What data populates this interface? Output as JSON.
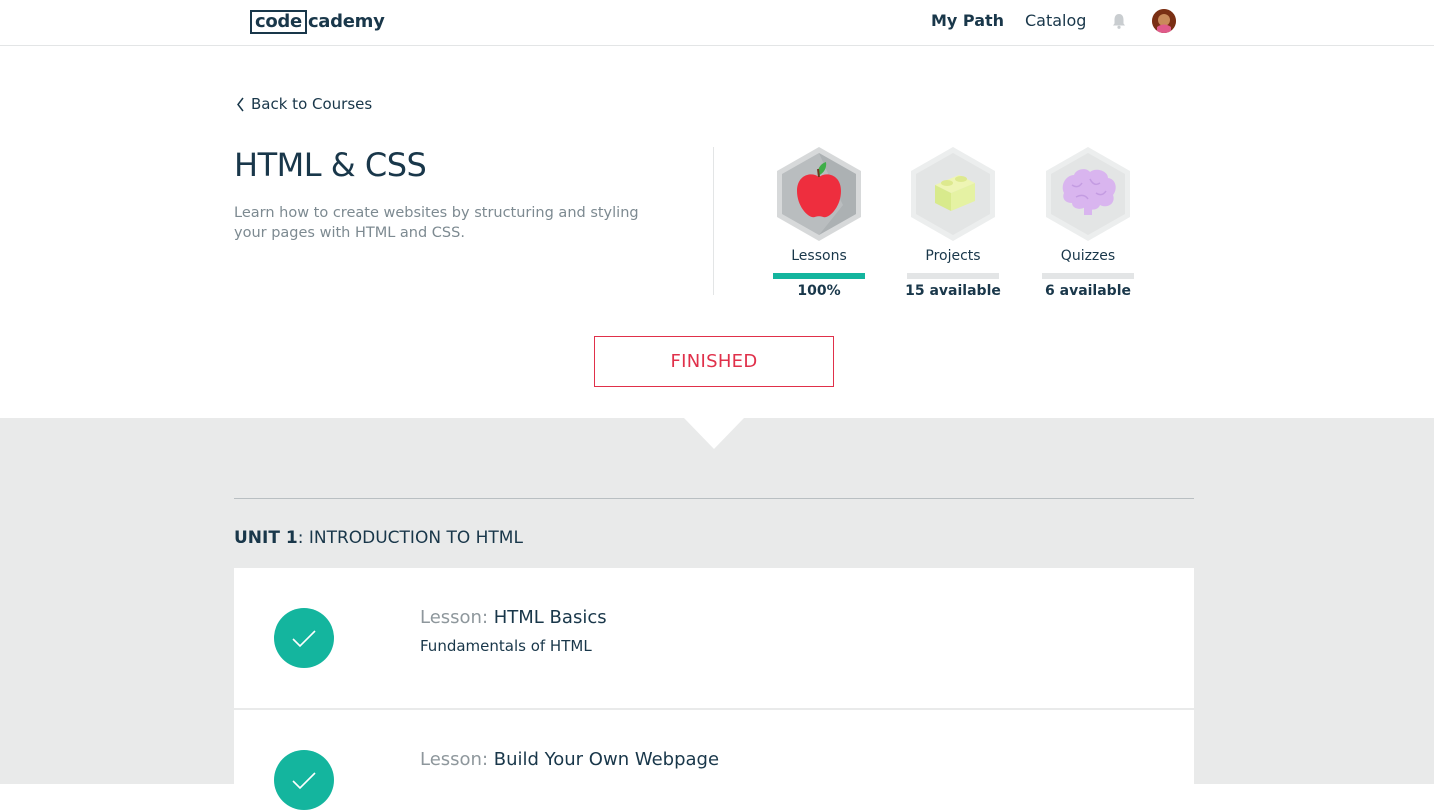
{
  "nav": {
    "logo_boxed": "code",
    "logo_rest": "cademy",
    "my_path": "My Path",
    "catalog": "Catalog",
    "bell_icon": "bell-icon",
    "avatar_icon": "user-avatar"
  },
  "header": {
    "back_label": "Back to Courses",
    "title": "HTML & CSS",
    "description": "Learn how to create websites by structuring and styling your pages with HTML and CSS."
  },
  "stats": [
    {
      "label": "Lessons",
      "value": "100%",
      "progress": 1.0,
      "icon": "apple-icon"
    },
    {
      "label": "Projects",
      "value": "15 available",
      "progress": 0,
      "icon": "lego-brick-icon"
    },
    {
      "label": "Quizzes",
      "value": "6 available",
      "progress": 0,
      "icon": "brain-icon"
    }
  ],
  "status_button": "FINISHED",
  "unit": {
    "number_label": "UNIT 1",
    "title": ": INTRODUCTION TO HTML"
  },
  "lessons": [
    {
      "prefix": "Lesson: ",
      "name": "HTML Basics",
      "subtitle": "Fundamentals of HTML",
      "completed": true
    },
    {
      "prefix": "Lesson: ",
      "name": "Build Your Own Webpage",
      "subtitle": "",
      "completed": true
    }
  ],
  "colors": {
    "accent_teal": "#14b59e",
    "finished_red": "#e0304a",
    "navy": "#19374a",
    "grey_bg": "#e9eaea"
  }
}
